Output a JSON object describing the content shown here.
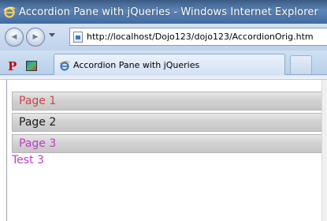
{
  "window": {
    "title": "Accordion Pane with jQueries - Windows Internet Explorer"
  },
  "navigation": {
    "back_glyph": "◀",
    "forward_glyph": "▶",
    "address": "http://localhost/Dojo123/dojo123/AccordionOrig.htm"
  },
  "favorites": {
    "p_icon_text": "P"
  },
  "tabs": [
    {
      "label": "Accordion Pane with jQueries",
      "active": true
    }
  ],
  "accordion": {
    "panes": [
      {
        "header": "Page 1",
        "color": "#c8474d"
      },
      {
        "header": "Page 2",
        "color": "#1a1a1a"
      },
      {
        "header": "Page 3",
        "color": "#c03cc8"
      }
    ],
    "open_content": {
      "text": "Test 3",
      "color": "#c03cc8"
    }
  },
  "colors": {
    "titlebar": "#4a73a8",
    "toolbar": "#c9dbef",
    "accordion_header": "#d0d0d0"
  }
}
